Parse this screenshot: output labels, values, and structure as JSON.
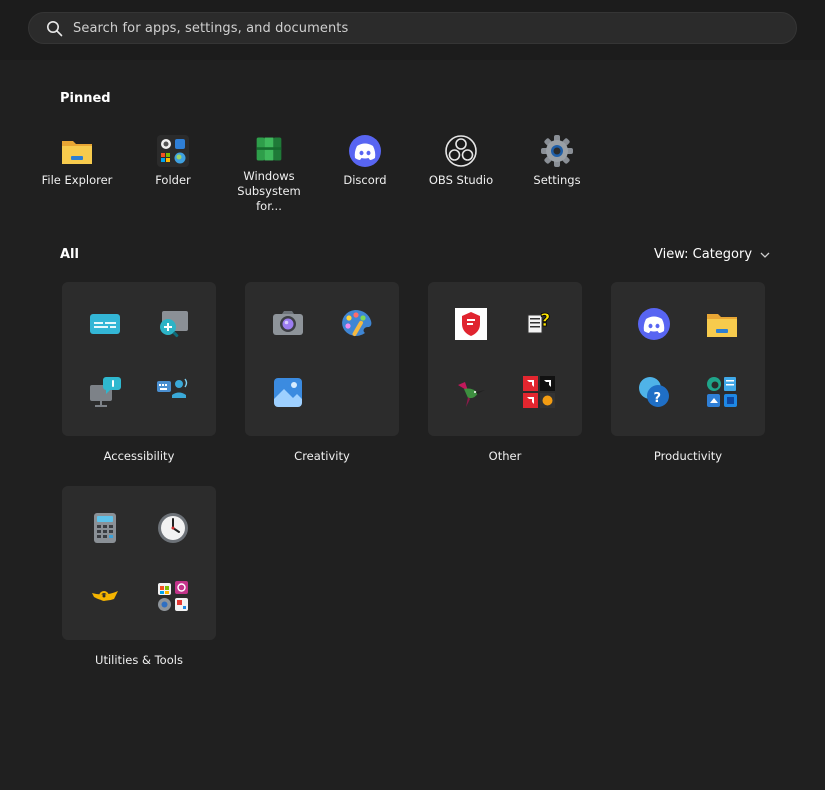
{
  "search": {
    "placeholder": "Search for apps, settings, and documents"
  },
  "pinned": {
    "title": "Pinned",
    "items": [
      {
        "label": "File Explorer",
        "icon": "file-explorer-icon"
      },
      {
        "label": "Folder",
        "icon": "folder-group-icon"
      },
      {
        "label": "Windows Subsystem for...",
        "icon": "wsa-icon"
      },
      {
        "label": "Discord",
        "icon": "discord-icon"
      },
      {
        "label": "OBS Studio",
        "icon": "obs-icon"
      },
      {
        "label": "Settings",
        "icon": "settings-gear-icon"
      }
    ]
  },
  "all": {
    "title": "All",
    "view_label": "View: Category",
    "categories": [
      {
        "label": "Accessibility",
        "icons": [
          "live-captions-icon",
          "magnifier-icon",
          "narrator-icon",
          "voice-access-icon"
        ]
      },
      {
        "label": "Creativity",
        "icons": [
          "camera-icon",
          "paint-icon",
          "photos-icon"
        ]
      },
      {
        "label": "Other",
        "icons": [
          "red-shield-app-icon",
          "help-document-icon",
          "hummingbird-icon",
          "amd-apps-icon"
        ]
      },
      {
        "label": "Productivity",
        "icons": [
          "discord-icon",
          "file-explorer-icon",
          "get-help-icon",
          "edge-notepad-group-icon"
        ]
      },
      {
        "label": "Utilities & Tools",
        "icons": [
          "calculator-icon",
          "clock-icon",
          "horn-icon",
          "store-tools-group-icon"
        ]
      }
    ]
  },
  "colors": {
    "background": "#202020",
    "tile": "#2c2c2c",
    "discord": "#5865f2",
    "folder": "#f6c445",
    "accent": "#3b9cd9"
  }
}
